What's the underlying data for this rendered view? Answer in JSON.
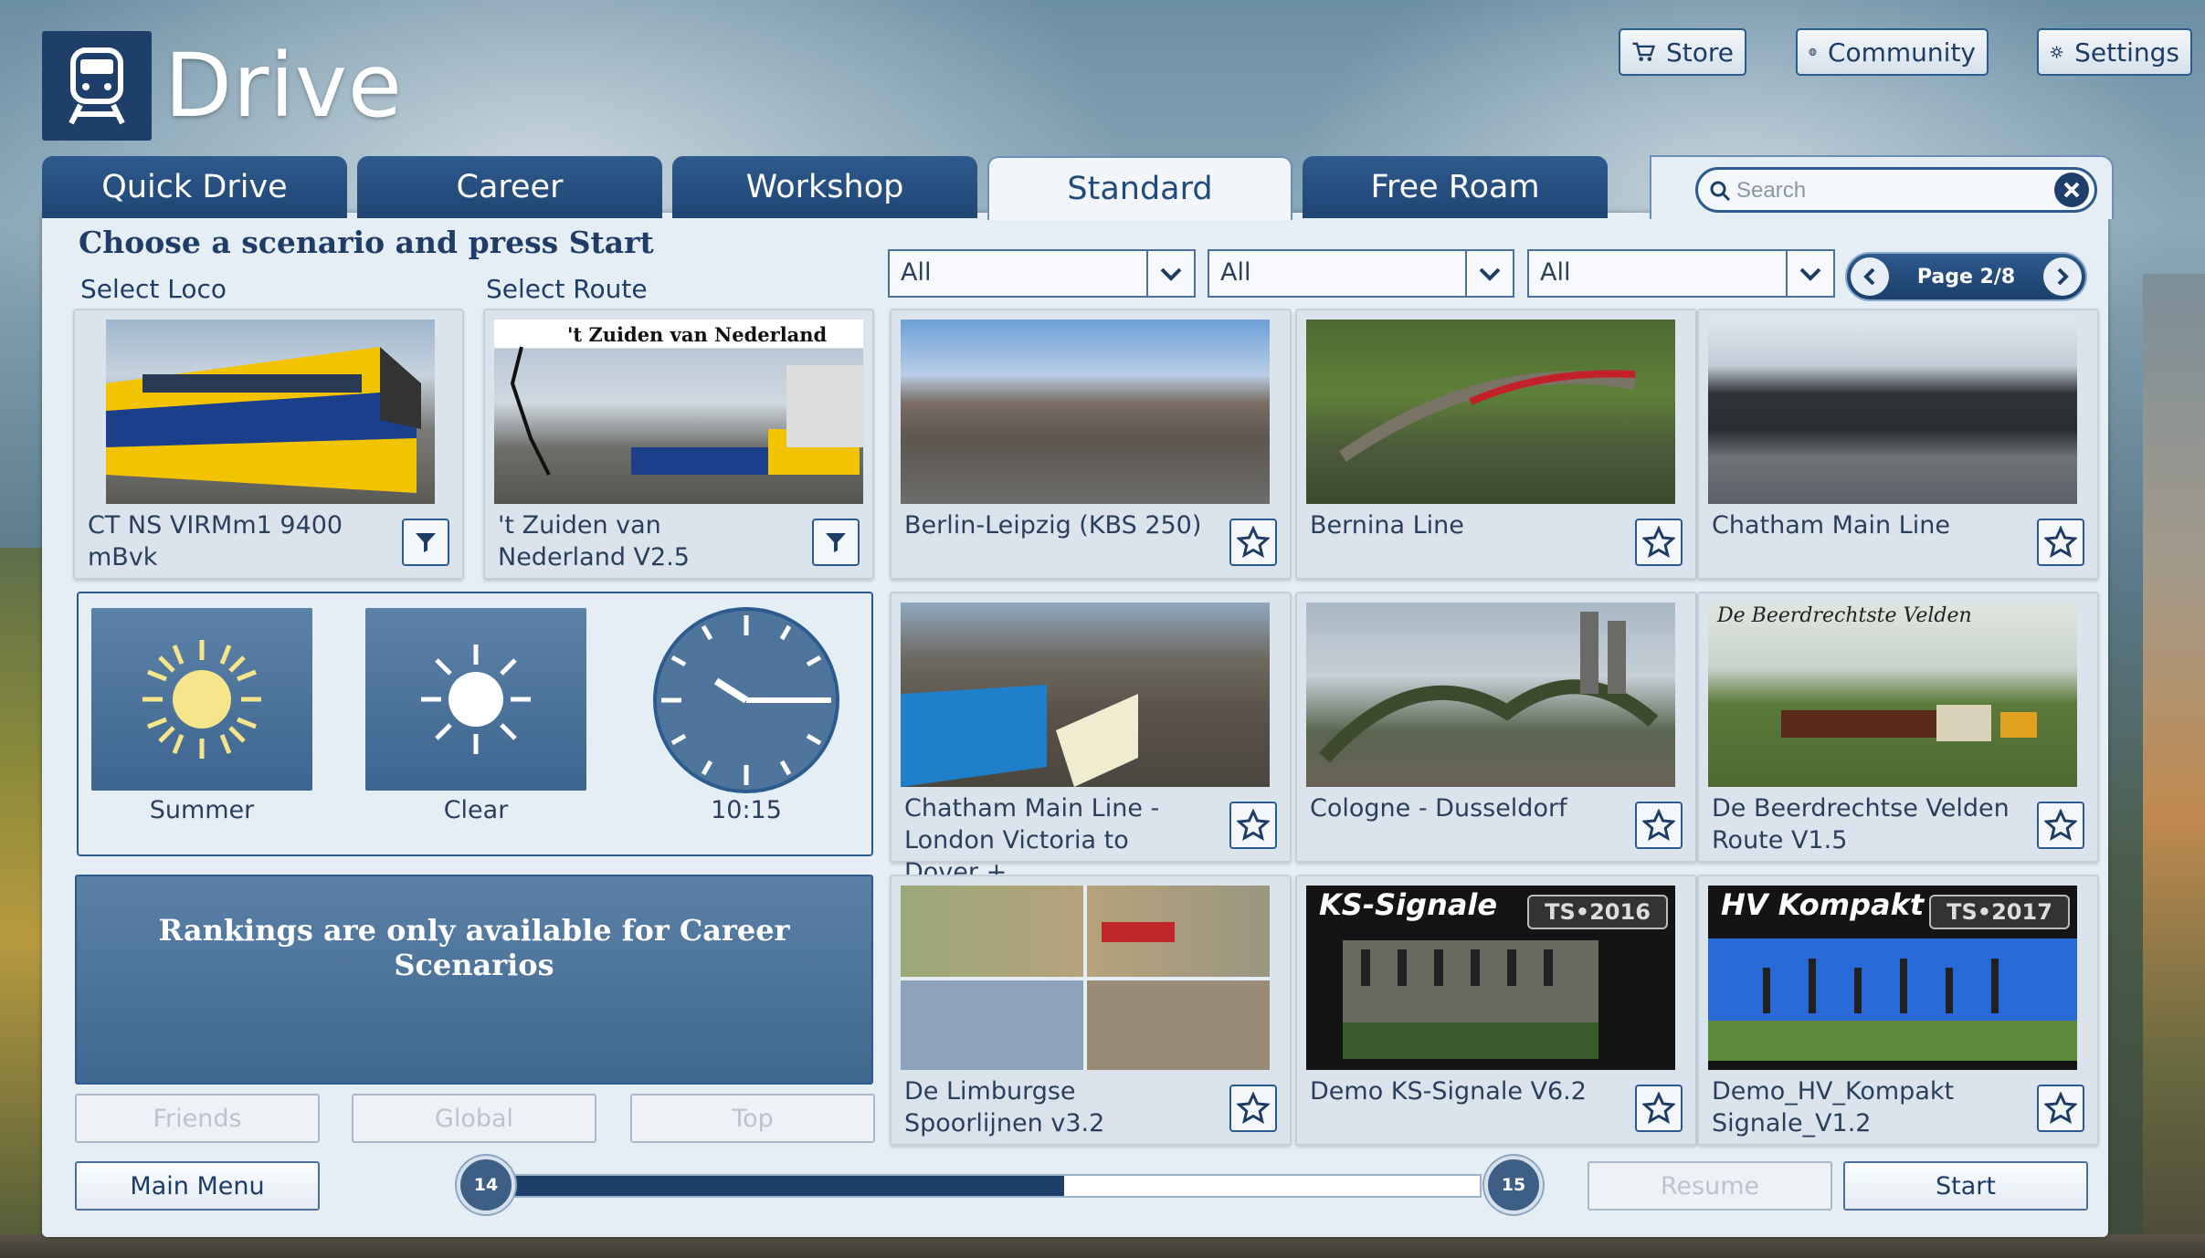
{
  "app": {
    "title": "Drive"
  },
  "top_buttons": {
    "store": "Store",
    "community": "Community",
    "settings": "Settings"
  },
  "tabs": [
    {
      "label": "Quick Drive",
      "active": false
    },
    {
      "label": "Career",
      "active": false
    },
    {
      "label": "Workshop",
      "active": false
    },
    {
      "label": "Standard",
      "active": true
    },
    {
      "label": "Free Roam",
      "active": false
    }
  ],
  "search": {
    "placeholder": "Search",
    "value": ""
  },
  "main": {
    "heading": "Choose a scenario and press Start",
    "select_loco_label": "Select Loco",
    "select_route_label": "Select Route",
    "filters": [
      "All",
      "All",
      "All"
    ],
    "page": "Page 2/8"
  },
  "loco": {
    "label": "CT NS VIRMm1 9400 mBvk"
  },
  "route": {
    "label": "'t Zuiden van Nederland V2.5",
    "thumb_title": "'t Zuiden van Nederland"
  },
  "routes": [
    {
      "name": "Berlin-Leipzig (KBS 250)"
    },
    {
      "name": "Bernina Line"
    },
    {
      "name": "Chatham Main Line"
    },
    {
      "name": "Chatham Main Line - London Victoria to Dover +"
    },
    {
      "name": "Cologne - Dusseldorf"
    },
    {
      "name": "De Beerdrechtse Velden Route V1.5",
      "thumb_title": "De Beerdrechtste Velden"
    },
    {
      "name": "De Limburgse Spoorlijnen v3.2"
    },
    {
      "name": "Demo KS-Signale V6.2",
      "thumb_title": "KS-Signale",
      "thumb_badge": "TS•2016"
    },
    {
      "name": "Demo_HV_Kompakt Signale_V1.2",
      "thumb_title": "HV Kompakt",
      "thumb_badge": "TS•2017"
    }
  ],
  "environment": {
    "season": "Summer",
    "weather": "Clear",
    "time": "10:15"
  },
  "rankings": {
    "message": "Rankings are only available for Career Scenarios",
    "buttons": [
      "Friends",
      "Global",
      "Top"
    ]
  },
  "footer": {
    "main_menu": "Main Menu",
    "resume": "Resume",
    "start": "Start",
    "slider_min": "14",
    "slider_max": "15",
    "slider_fraction": 0.57
  },
  "colors": {
    "primary": "#1f3f6b",
    "accent": "#2b5b8f",
    "panel": "#e6eef5",
    "sun": "#f6e58a"
  }
}
